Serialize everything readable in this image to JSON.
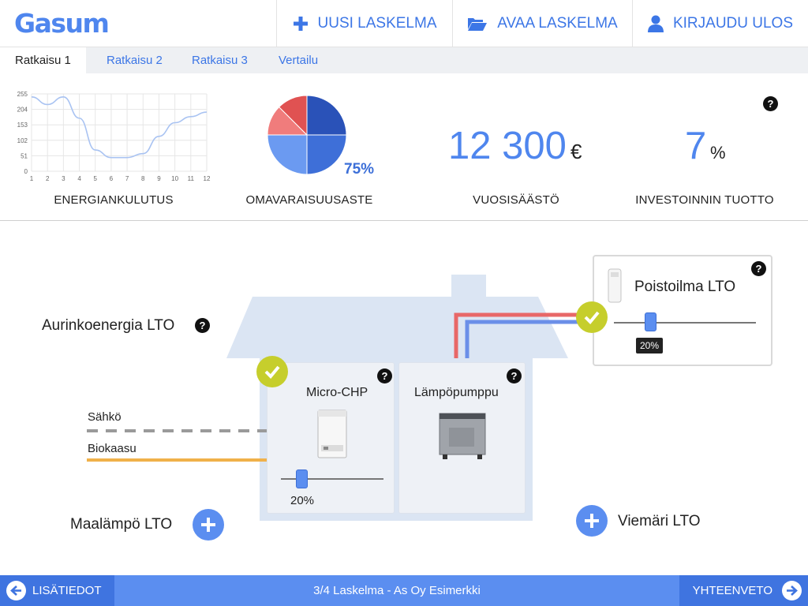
{
  "brand": {
    "logo": "Gasum",
    "accent": "#4f86ee",
    "dark_accent": "#3f74e0",
    "check_color": "#c6ce2c"
  },
  "header": {
    "new_calc": "UUSI LASKELMA",
    "open_calc": "AVAA LASKELMA",
    "logout": "KIRJAUDU ULOS"
  },
  "tabs": [
    {
      "label": "Ratkaisu 1",
      "active": true
    },
    {
      "label": "Ratkaisu 2",
      "active": false
    },
    {
      "label": "Ratkaisu 3",
      "active": false
    },
    {
      "label": "Vertailu",
      "active": false
    }
  ],
  "summary": {
    "energy_label": "ENERGIANKULUTUS",
    "selfsuff_label": "OMAVARAISUUSASTE",
    "selfsuff_value": "75%",
    "savings_label": "VUOSISÄÄSTÖ",
    "savings_value": "12 300",
    "savings_unit": "€",
    "roi_label": "INVESTOINNIN TUOTTO",
    "roi_value": "7",
    "roi_unit": "%",
    "help": "?"
  },
  "chart_data": [
    {
      "type": "line",
      "x": [
        1,
        2,
        3,
        4,
        5,
        6,
        7,
        8,
        9,
        10,
        11,
        12
      ],
      "series": [
        {
          "values": [
            245,
            220,
            245,
            175,
            70,
            45,
            45,
            58,
            115,
            160,
            180,
            195
          ]
        }
      ],
      "yticks": [
        0,
        51,
        102,
        153,
        204,
        255
      ],
      "xticks": [
        1,
        2,
        3,
        4,
        5,
        6,
        7,
        8,
        9,
        10,
        11,
        12
      ],
      "ylim": [
        0,
        255
      ],
      "grid": true,
      "color": "#a9c3f2"
    },
    {
      "type": "pie",
      "slices": [
        {
          "value": 25,
          "color": "#2a52b8"
        },
        {
          "value": 25,
          "color": "#3e6fd8"
        },
        {
          "value": 25,
          "color": "#6b9af1"
        },
        {
          "value": 12.5,
          "color": "#f07c7c"
        },
        {
          "value": 12.5,
          "color": "#e05252"
        }
      ]
    }
  ],
  "diagram": {
    "solar_lto": "Aurinkoenergia LTO",
    "ground_lto": "Maalämpö LTO",
    "sewer_lto": "Viemäri LTO",
    "electricity": "Sähkö",
    "biogas": "Biokaasu",
    "micro_chp": {
      "title": "Micro-CHP",
      "value": "20%",
      "level": 0.2
    },
    "heat_pump": {
      "title": "Lämpöpumppu"
    },
    "exhaust_lto": {
      "title": "Poistoilma LTO",
      "value": "20%",
      "level": 0.2
    }
  },
  "footer": {
    "more_info": "LISÄTIEDOT",
    "calc_status": "3/4 Laskelma  -  As Oy Esimerkki",
    "summary": "YHTEENVETO"
  },
  "icons": {
    "new": "plus-icon",
    "open": "folder-open-icon",
    "logout": "user-icon",
    "back": "arrow-left-circle-icon",
    "forward": "arrow-right-circle-icon"
  }
}
